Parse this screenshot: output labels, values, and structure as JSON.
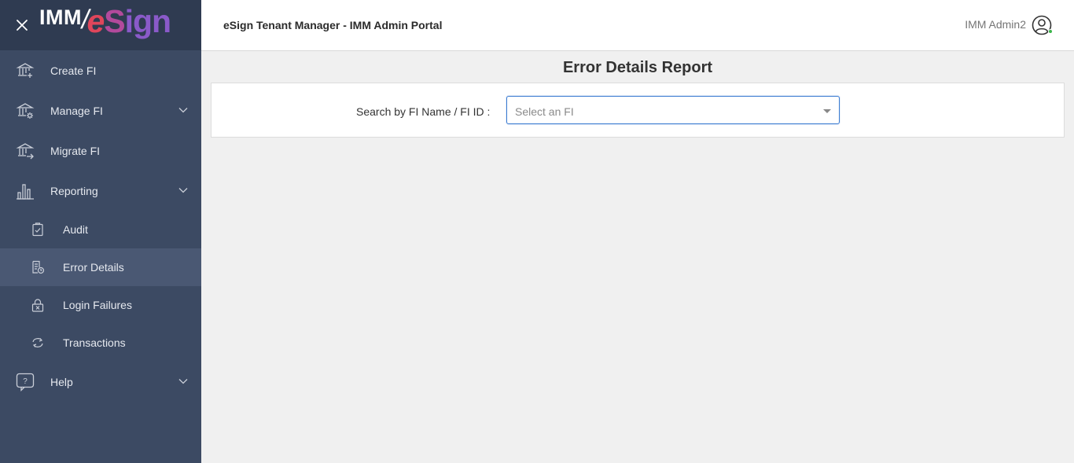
{
  "sidebar": {
    "logo": {
      "imm": "IMM",
      "slash": "/",
      "e": "e",
      "s": "S",
      "ign": "ign"
    },
    "items": [
      {
        "label": "Create FI",
        "icon": "bank-plus-icon"
      },
      {
        "label": "Manage FI",
        "icon": "bank-gear-icon"
      },
      {
        "label": "Migrate FI",
        "icon": "bank-arrow-icon"
      },
      {
        "label": "Reporting",
        "icon": "bar-chart-icon"
      },
      {
        "label": "Help",
        "icon": "help-bubble-icon"
      }
    ],
    "reporting_sub": [
      {
        "label": "Audit",
        "icon": "clipboard-check-icon"
      },
      {
        "label": "Error Details",
        "icon": "document-clock-icon",
        "active": true
      },
      {
        "label": "Login Failures",
        "icon": "lock-x-icon"
      },
      {
        "label": "Transactions",
        "icon": "cycle-arrows-icon"
      }
    ]
  },
  "header": {
    "title": "eSign Tenant Manager - IMM Admin Portal",
    "user": "IMM Admin2",
    "status_color": "#3bb54a"
  },
  "main": {
    "page_title": "Error Details Report",
    "search_label": "Search by FI Name / FI ID :",
    "select_placeholder": "Select an FI"
  },
  "colors": {
    "sidebar_bg": "#3c4a63",
    "brand_bg": "#2f3b51",
    "active_bg": "#4a5873",
    "focus_border": "#3b7bd1"
  }
}
